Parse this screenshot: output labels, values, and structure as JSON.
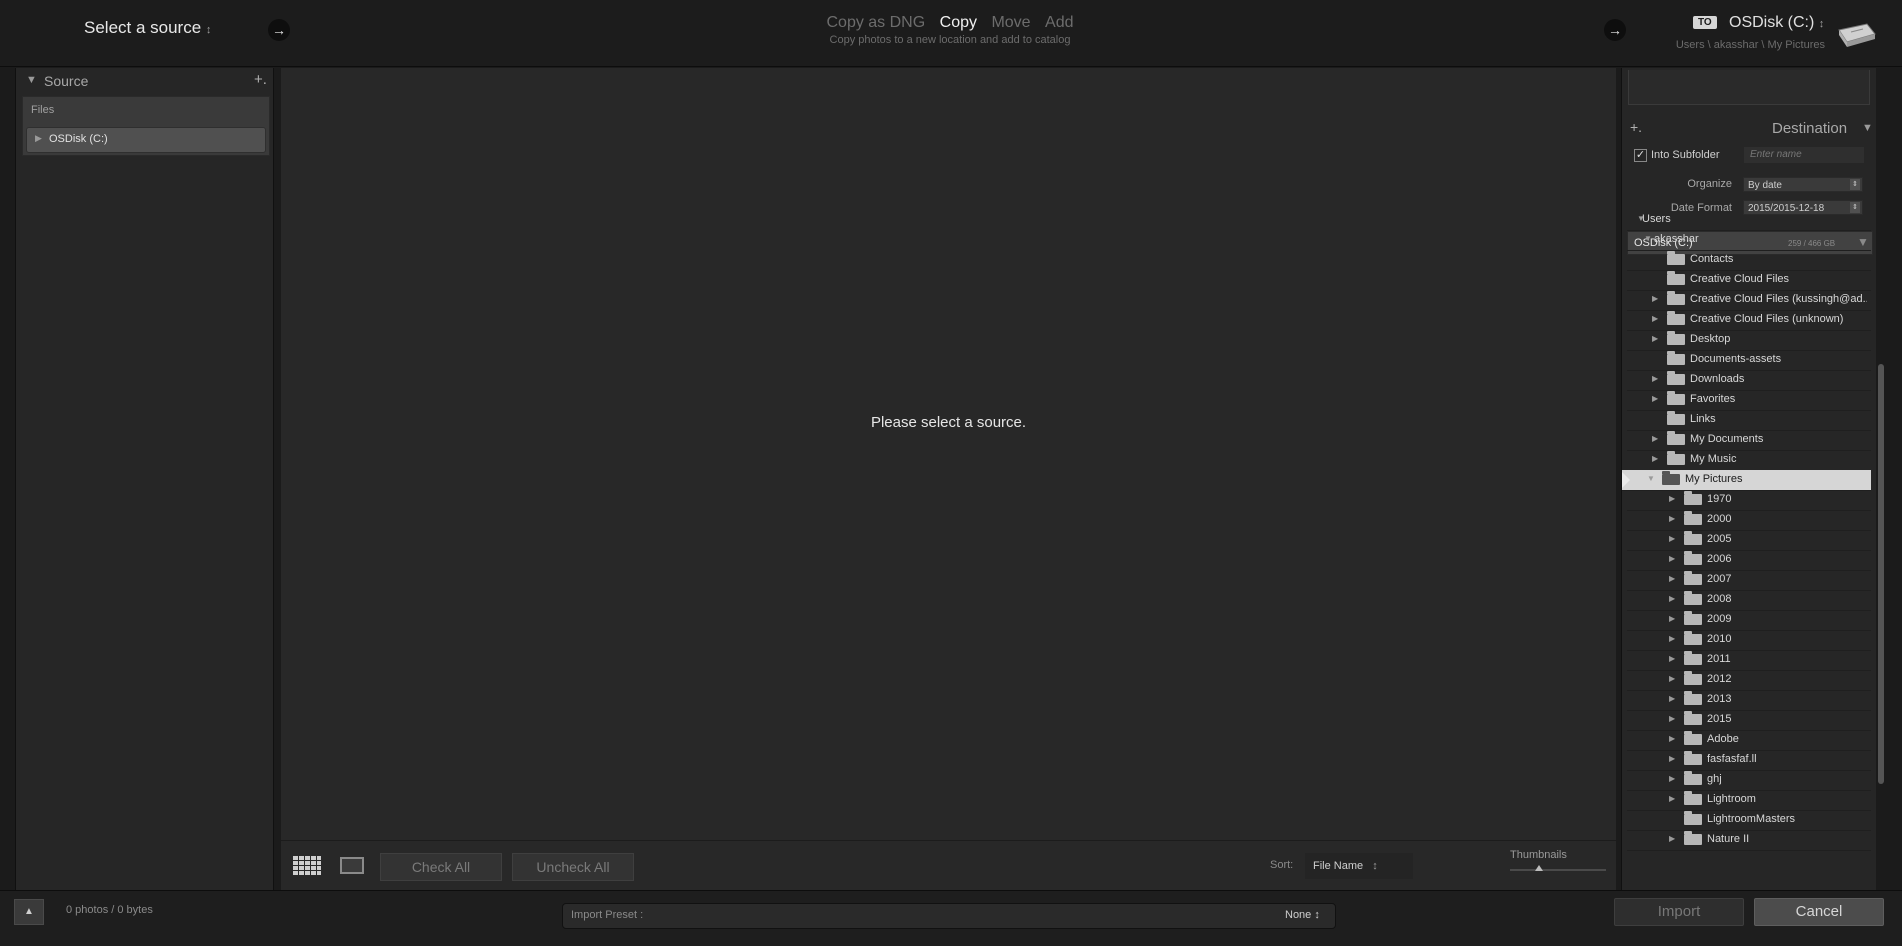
{
  "source": {
    "select_label": "Select a source",
    "select_arrows": "↕",
    "panel_title": "Source",
    "add_label": "+.",
    "files_label": "Files",
    "volume": "OSDisk (C:)"
  },
  "modes": {
    "items": [
      "Copy as DNG",
      "Copy",
      "Move",
      "Add"
    ],
    "active": "Copy",
    "subtitle": "Copy photos to a new location and add to catalog"
  },
  "destination": {
    "to_badge": "TO",
    "disk": "OSDisk (C:)",
    "disk_arrows": "↕",
    "path": "Users \\ akasshar \\ My Pictures",
    "panel_title": "Destination",
    "add_label": "+.",
    "into_subfolder_label": "Into Subfolder",
    "into_subfolder_checked": true,
    "subfolder_placeholder": "Enter name",
    "organize_label": "Organize",
    "organize_value": "By date",
    "date_format_label": "Date Format",
    "date_format_value": "2015/2015-12-18",
    "volume_name": "OSDisk (C:)",
    "volume_size": "259 / 466 GB",
    "tree": [
      {
        "label": "Users",
        "level": 0,
        "tri": "▼",
        "folder": false
      },
      {
        "label": "akasshar",
        "level": 1,
        "tri": "▼",
        "folder": false
      },
      {
        "label": "Contacts",
        "level": 2,
        "tri": "",
        "folder": true
      },
      {
        "label": "Creative Cloud Files",
        "level": 2,
        "tri": "",
        "folder": true
      },
      {
        "label": "Creative Cloud Files (kussingh@ad...",
        "level": 2,
        "tri": "▶",
        "folder": true
      },
      {
        "label": "Creative Cloud Files (unknown)",
        "level": 2,
        "tri": "▶",
        "folder": true
      },
      {
        "label": "Desktop",
        "level": 2,
        "tri": "▶",
        "folder": true
      },
      {
        "label": "Documents-assets",
        "level": 2,
        "tri": "",
        "folder": true
      },
      {
        "label": "Downloads",
        "level": 2,
        "tri": "▶",
        "folder": true
      },
      {
        "label": "Favorites",
        "level": 2,
        "tri": "▶",
        "folder": true
      },
      {
        "label": "Links",
        "level": 2,
        "tri": "",
        "folder": true
      },
      {
        "label": "My Documents",
        "level": 2,
        "tri": "▶",
        "folder": true
      },
      {
        "label": "My Music",
        "level": 2,
        "tri": "▶",
        "folder": true
      },
      {
        "label": "My Pictures",
        "level": 2,
        "tri": "▼",
        "folder": true,
        "selected": true
      },
      {
        "label": "1970",
        "level": 3,
        "tri": "▶",
        "folder": true
      },
      {
        "label": "2000",
        "level": 3,
        "tri": "▶",
        "folder": true
      },
      {
        "label": "2005",
        "level": 3,
        "tri": "▶",
        "folder": true
      },
      {
        "label": "2006",
        "level": 3,
        "tri": "▶",
        "folder": true
      },
      {
        "label": "2007",
        "level": 3,
        "tri": "▶",
        "folder": true
      },
      {
        "label": "2008",
        "level": 3,
        "tri": "▶",
        "folder": true
      },
      {
        "label": "2009",
        "level": 3,
        "tri": "▶",
        "folder": true
      },
      {
        "label": "2010",
        "level": 3,
        "tri": "▶",
        "folder": true
      },
      {
        "label": "2011",
        "level": 3,
        "tri": "▶",
        "folder": true
      },
      {
        "label": "2012",
        "level": 3,
        "tri": "▶",
        "folder": true
      },
      {
        "label": "2013",
        "level": 3,
        "tri": "▶",
        "folder": true
      },
      {
        "label": "2015",
        "level": 3,
        "tri": "▶",
        "folder": true
      },
      {
        "label": "Adobe",
        "level": 3,
        "tri": "▶",
        "folder": true
      },
      {
        "label": "fasfasfaf.ll",
        "level": 3,
        "tri": "▶",
        "folder": true
      },
      {
        "label": "ghj",
        "level": 3,
        "tri": "▶",
        "folder": true
      },
      {
        "label": "Lightroom",
        "level": 3,
        "tri": "▶",
        "folder": true
      },
      {
        "label": "LightroomMasters",
        "level": 3,
        "tri": "",
        "folder": true
      },
      {
        "label": "Nature II",
        "level": 3,
        "tri": "▶",
        "folder": true
      }
    ]
  },
  "center": {
    "empty_message": "Please select a source.",
    "check_all": "Check All",
    "uncheck_all": "Uncheck All",
    "sort_label": "Sort:",
    "sort_value": "File Name",
    "sort_arrows": "↕",
    "thumbnails_label": "Thumbnails",
    "thumbnail_size": 0.3
  },
  "bottom": {
    "collapse_icon": "▲",
    "photo_count": "0 photos / 0 bytes",
    "import_preset_label": "Import Preset :",
    "import_preset_value": "None ↕",
    "import_button": "Import",
    "cancel_button": "Cancel"
  },
  "icons": {
    "arrow": "→"
  }
}
